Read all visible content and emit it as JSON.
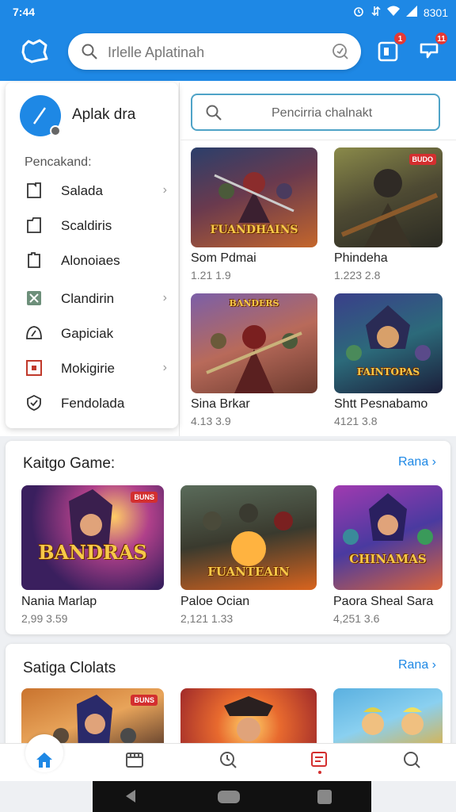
{
  "status_bar": {
    "time": "7:44",
    "right_text": "8301"
  },
  "header": {
    "search_placeholder": "Irlelle Aplatinah",
    "notif_badge": "1",
    "alert_badge": "11"
  },
  "side_menu": {
    "title": "Aplak dra",
    "section_label": "Pencakand:",
    "items": [
      {
        "label": "Salada",
        "chevron": true
      },
      {
        "label": "Scaldiris",
        "chevron": false
      },
      {
        "label": "Alonoiaes",
        "chevron": false
      },
      {
        "label": "Clandirin",
        "chevron": true
      },
      {
        "label": "Gapiciak",
        "chevron": false
      },
      {
        "label": "Mokigirie",
        "chevron": true
      },
      {
        "label": "Fendolada",
        "chevron": false
      }
    ]
  },
  "right_panel": {
    "search_placeholder": "Pencirria chalnakt",
    "games": [
      {
        "name": "Som Pdmai",
        "meta": "1.21 1.9",
        "banner": "FUANDHAINS",
        "tag": ""
      },
      {
        "name": "Phindeha",
        "meta": "1.223 2.8",
        "banner": "",
        "tag": "BUDO"
      },
      {
        "name": "Sina Brkar",
        "meta": "4.13 3.9",
        "banner": "BANDERS",
        "tag": ""
      },
      {
        "name": "Shtt Pesnabamo",
        "meta": "4121 3.8",
        "banner": "FAINTOPAS",
        "tag": ""
      }
    ]
  },
  "sections": [
    {
      "title": "Kaitgo Game:",
      "more": "Rana",
      "games": [
        {
          "name": "Nania Marlap",
          "meta": "2,99 3.59",
          "banner": "BANDRAS",
          "tag": "BUNS"
        },
        {
          "name": "Paloe Ocian",
          "meta": "2,121 1.33",
          "banner": "FUANTEAIN",
          "tag": ""
        },
        {
          "name": "Paora Sheal Sara",
          "meta": "4,251 3.6",
          "banner": "CHINAMAS",
          "tag": ""
        }
      ]
    },
    {
      "title": "Satiga Clolats",
      "more": "Rana",
      "games": [
        {
          "name": "",
          "meta": "",
          "banner": "",
          "tag": "BUNS"
        },
        {
          "name": "",
          "meta": "",
          "banner": "",
          "tag": ""
        },
        {
          "name": "",
          "meta": "",
          "banner": "",
          "tag": ""
        }
      ]
    }
  ],
  "colors": {
    "primary": "#1e88e5",
    "badge": "#e53935",
    "accent_red": "#d32f2f"
  },
  "bottom_nav": {
    "items": [
      "home-icon",
      "store-icon",
      "update-icon",
      "library-icon",
      "search-icon"
    ],
    "active": 0
  }
}
